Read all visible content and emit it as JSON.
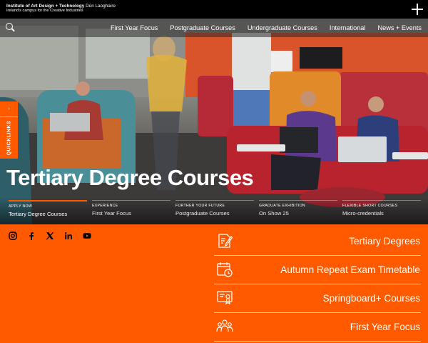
{
  "header": {
    "logo_line1": "Institute of Art Design + Technology",
    "logo_line1_suffix": "Dún Laoghaire",
    "logo_line2": "Ireland's campus for the Creative Industries",
    "menu_icon": "plus-icon"
  },
  "nav": {
    "search_icon": "search-icon",
    "links": [
      "First Year Focus",
      "Postgraduate Courses",
      "Undergraduate Courses",
      "International",
      "News + Events"
    ]
  },
  "quicklinks": {
    "arrow": "›",
    "label": "QUICKLINKS"
  },
  "hero": {
    "title": "Tertiary Degree Courses"
  },
  "strip": [
    {
      "kicker": "APPLY NOW",
      "title": "Tertiary Degree Courses",
      "active": true
    },
    {
      "kicker": "EXPERIENCE",
      "title": "First Year Focus"
    },
    {
      "kicker": "FURTHER YOUR FUTURE",
      "title": "Postgraduate Courses"
    },
    {
      "kicker": "GRADUATE EXHIBITION",
      "title": "On Show 25"
    },
    {
      "kicker": "FLEXIBLE SHORT COURSES",
      "title": "Micro-credentials"
    }
  ],
  "socials": [
    "instagram-icon",
    "facebook-icon",
    "x-icon",
    "linkedin-icon",
    "youtube-icon"
  ],
  "quick_links": [
    {
      "label": "Tertiary Degrees",
      "icon": "document-edit-icon"
    },
    {
      "label": "Autumn Repeat Exam Timetable",
      "icon": "calendar-clock-icon"
    },
    {
      "label": "Springboard+ Courses",
      "icon": "certificate-icon"
    },
    {
      "label": "First Year Focus",
      "icon": "people-group-icon"
    }
  ],
  "colors": {
    "accent": "#ff5a00",
    "topbar": "#000000"
  }
}
